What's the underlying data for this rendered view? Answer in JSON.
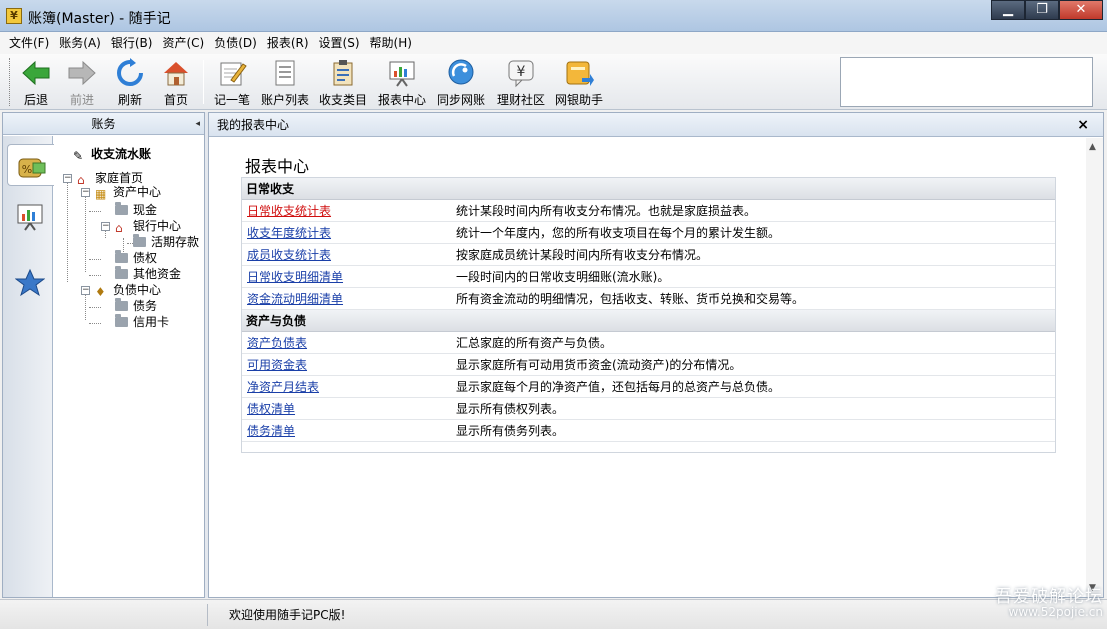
{
  "window": {
    "title": "账簿(Master) - 随手记",
    "app_icon_glyph": "¥",
    "controls": {
      "minimize": "▁",
      "maximize": "❐",
      "close": "✕"
    }
  },
  "menu": [
    {
      "label": "文件(F)"
    },
    {
      "label": "账务(A)"
    },
    {
      "label": "银行(B)"
    },
    {
      "label": "资产(C)"
    },
    {
      "label": "负债(D)"
    },
    {
      "label": "报表(R)"
    },
    {
      "label": "设置(S)"
    },
    {
      "label": "帮助(H)"
    }
  ],
  "toolbar": {
    "back": "后退",
    "forward": "前进",
    "refresh": "刷新",
    "home": "首页",
    "record": "记一笔",
    "accounts": "账户列表",
    "categories": "收支类目",
    "reports": "报表中心",
    "sync": "同步网账",
    "community": "理财社区",
    "ebank": "网银助手",
    "search_value": ""
  },
  "left_panel": {
    "header": "账务",
    "tree": {
      "root_label": "收支流水账",
      "home": "家庭首页",
      "assets": "资产中心",
      "cash": "现金",
      "bank": "银行中心",
      "demand_deposit": "活期存款",
      "claims": "债权",
      "other_funds": "其他资金",
      "liabilities": "负债中心",
      "debts": "债务",
      "credit_card": "信用卡"
    }
  },
  "main_panel": {
    "header": "我的报表中心",
    "close_glyph": "×",
    "title": "报表中心",
    "sections": [
      {
        "heading": "日常收支",
        "rows": [
          {
            "link": "日常收支统计表",
            "desc": "统计某段时间内所有收支分布情况。也就是家庭损益表。"
          },
          {
            "link": "收支年度统计表",
            "desc": "统计一个年度内，您的所有收支项目在每个月的累计发生额。"
          },
          {
            "link": "成员收支统计表",
            "desc": "按家庭成员统计某段时间内所有收支分布情况。"
          },
          {
            "link": "日常收支明细清单",
            "desc": "一段时间内的日常收支明细账(流水账)。"
          },
          {
            "link": "资金流动明细清单",
            "desc": "所有资金流动的明细情况，包括收支、转账、货币兑换和交易等。"
          }
        ]
      },
      {
        "heading": "资产与负债",
        "rows": [
          {
            "link": "资产负债表",
            "desc": "汇总家庭的所有资产与负债。"
          },
          {
            "link": "可用资金表",
            "desc": "显示家庭所有可动用货币资金(流动资产)的分布情况。"
          },
          {
            "link": "净资产月结表",
            "desc": "显示家庭每个月的净资产值，还包括每月的总资产与总负债。"
          },
          {
            "link": "债权清单",
            "desc": "显示所有债权列表。"
          },
          {
            "link": "债务清单",
            "desc": "显示所有债务列表。"
          }
        ]
      }
    ]
  },
  "status": {
    "text": "欢迎使用随手记PC版!",
    "watermark_line1": "吾爱破解论坛",
    "watermark_line2": "www.52pojie.cn"
  },
  "colors": {
    "link": "#1a3fa8",
    "link_active": "#d01010",
    "title_bar": "#aec6e2"
  }
}
